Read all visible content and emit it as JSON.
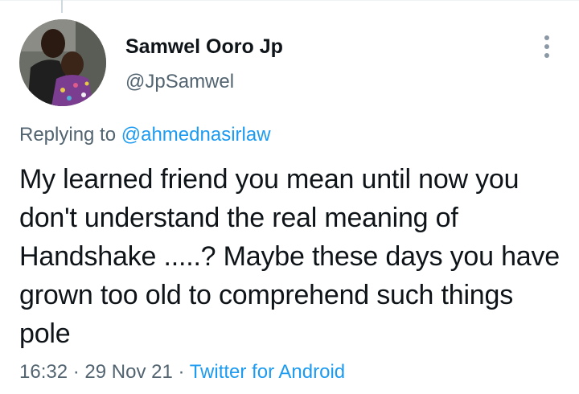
{
  "tweet": {
    "author": {
      "display_name": "Samwel Ooro Jp",
      "handle": "@JpSamwel"
    },
    "replying": {
      "prefix": "Replying to",
      "mention": "@ahmednasirlaw"
    },
    "text": "My learned friend you mean until now you don't understand the real meaning of Handshake .....? Maybe these days you have grown too old to comprehend such things pole",
    "time": "16:32",
    "separator": "·",
    "date": "29 Nov 21",
    "source": "Twitter for Android"
  },
  "icons": {
    "more": "more-vertical-icon"
  },
  "colors": {
    "accent": "#1d9bf0",
    "secondary_text": "#536471",
    "primary_text": "#0f1419"
  }
}
